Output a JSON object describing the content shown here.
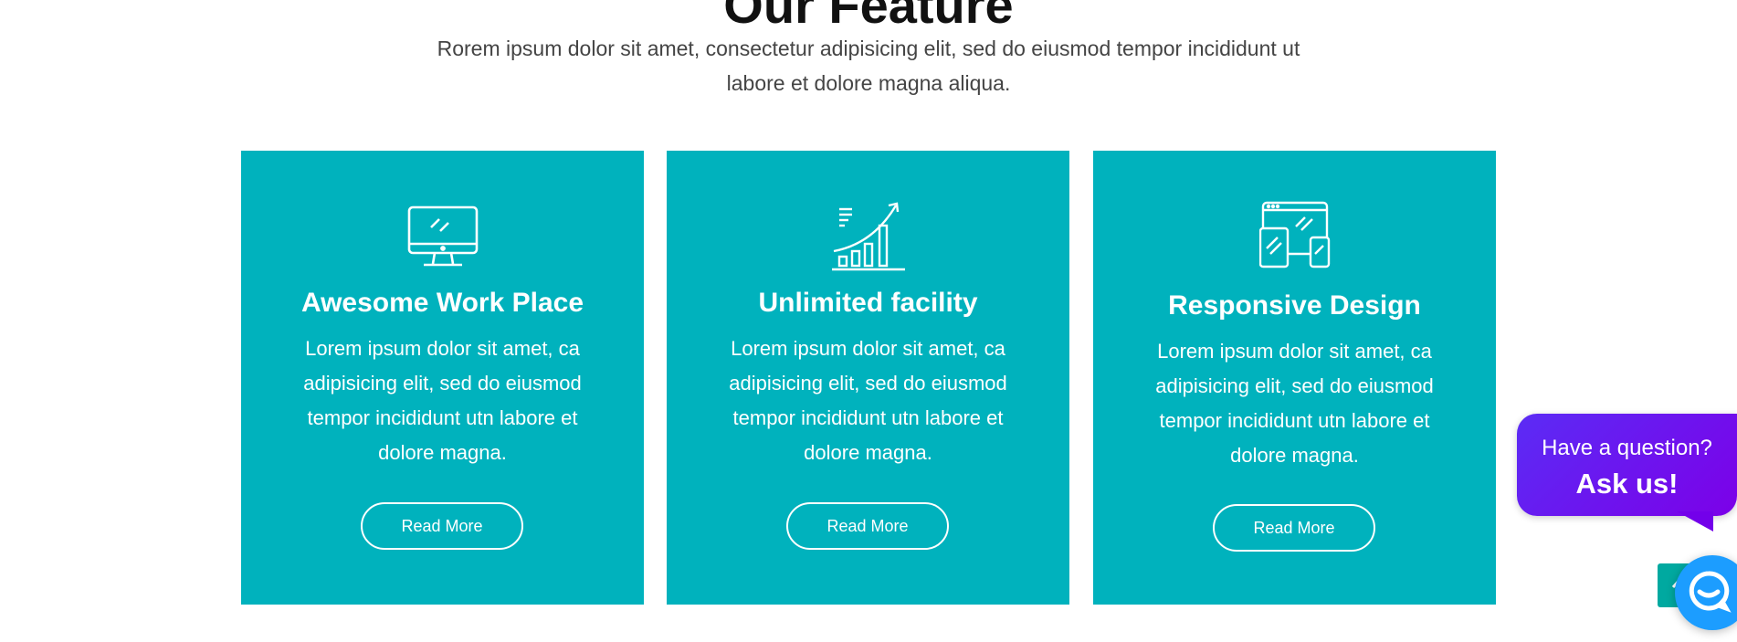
{
  "section": {
    "title": "Our Feature",
    "subtitle": "Rorem ipsum dolor sit amet, consectetur adipisicing elit, sed do eiusmod tempor incididunt ut labore et dolore magna aliqua."
  },
  "cards": [
    {
      "icon": "monitor-icon",
      "title": "Awesome Work Place",
      "text": "Lorem ipsum dolor sit amet, ca adipisicing elit, sed do eiusmod tempor incididunt utn labore et dolore magna.",
      "button": "Read More"
    },
    {
      "icon": "growth-chart-icon",
      "title": "Unlimited facility",
      "text": "Lorem ipsum dolor sit amet, ca adipisicing elit, sed do eiusmod tempor incididunt utn labore et dolore magna.",
      "button": "Read More"
    },
    {
      "icon": "responsive-devices-icon",
      "title": "Responsive Design",
      "text": "Lorem ipsum dolor sit amet, ca adipisicing elit, sed do eiusmod tempor incididunt utn labore et dolore magna.",
      "button": "Read More"
    }
  ],
  "chat": {
    "question": "Have a question?",
    "cta": "Ask us!",
    "launcher_icon": "chat-bubble-icon"
  },
  "scroll_top": {
    "icon": "arrow-up-icon"
  },
  "colors": {
    "card_background": "#00b2bd",
    "chat_gradient_start": "#5b2cf5",
    "chat_gradient_end": "#7c00e8",
    "launcher": "#1c9dff",
    "scroll_top": "#00a9a0"
  }
}
